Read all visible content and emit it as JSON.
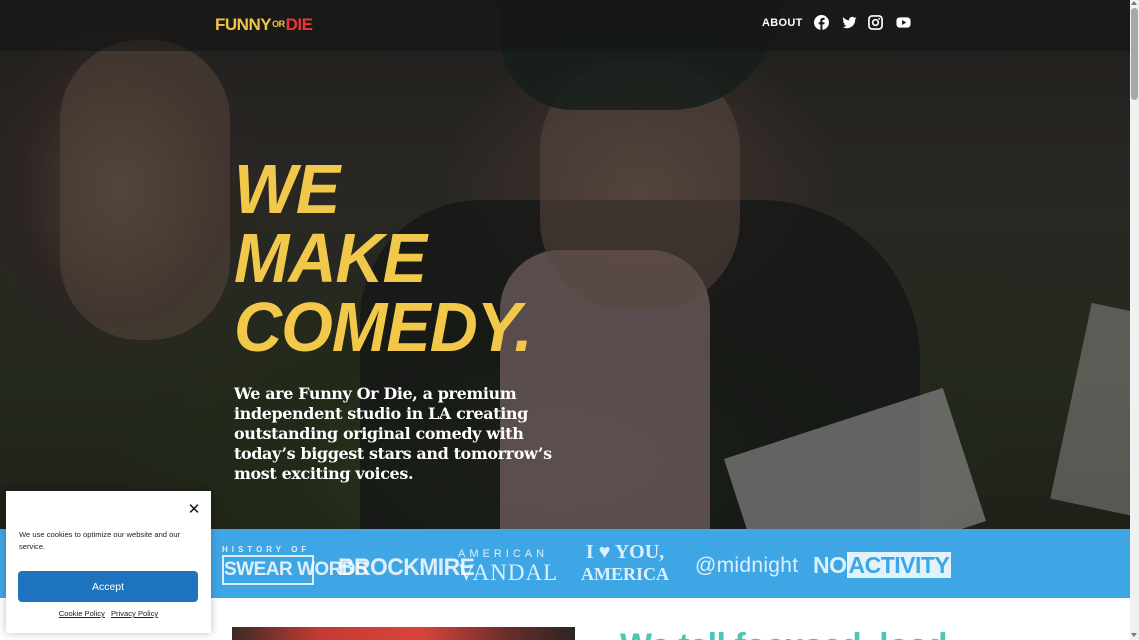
{
  "header": {
    "logo": {
      "funny": "FUNNY",
      "or": "OR",
      "die": "DIE"
    },
    "nav": {
      "about": "ABOUT"
    },
    "social": [
      "facebook-icon",
      "twitter-icon",
      "instagram-icon",
      "youtube-icon"
    ]
  },
  "hero": {
    "headline": [
      "WE",
      "MAKE",
      "COMEDY."
    ],
    "intro": "We are Funny Or Die, a premium independent studio in LA creating outstanding original comedy with today’s biggest stars and tomorrow’s most exciting voices."
  },
  "shows": {
    "swear_words": {
      "top": "HISTORY OF",
      "bottom": "SWEAR WORDS"
    },
    "brockmire": "BROCKMIRE",
    "american_vandal": {
      "top": "AMERICAN",
      "bottom": "VANDAL"
    },
    "i_love_you_america": {
      "top": "I ♥ YOU,",
      "bottom": "AMERICA"
    },
    "midnight": "@midnight",
    "no_activity": {
      "no": "NO",
      "activity": "ACTIVITY"
    }
  },
  "section": {
    "title": "We tell focused, load"
  },
  "cookie": {
    "message": "We use cookies to optimize our website and our service.",
    "accept": "Accept",
    "cookie_policy": "Cookie Policy",
    "privacy_policy": "Privacy Policy",
    "close": "✕"
  },
  "colors": {
    "headline": "#f2c84b",
    "logo_funny": "#f0c541",
    "logo_die": "#e7373c",
    "strip": "#3fa6e5",
    "accept_button": "#1e73be",
    "section_title": "#4bc7b5"
  }
}
